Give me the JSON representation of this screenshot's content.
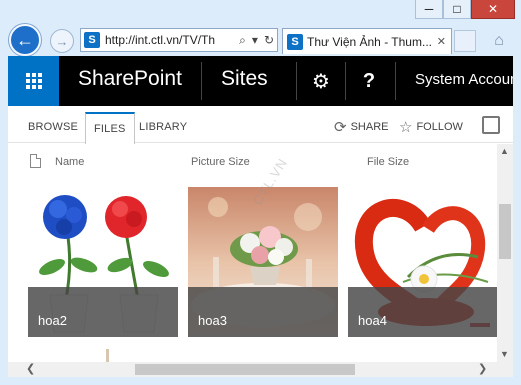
{
  "window": {
    "minimize_glyph": "─",
    "maximize_glyph": "□",
    "close_glyph": "✕"
  },
  "browser": {
    "back_glyph": "←",
    "forward_glyph": "→",
    "address_url": "http://int.ctl.vn/TV/Th",
    "search_glyph": "⌕",
    "dropdown_glyph": "▾",
    "refresh_glyph": "↻",
    "tab_title": "Thư Viện Ảnh - Thum...",
    "tab_close_glyph": "✕",
    "home_glyph": "⌂",
    "favicon_letter": "S"
  },
  "suitebar": {
    "brand": "SharePoint",
    "sites": "Sites",
    "gear_glyph": "⚙",
    "help_glyph": "?",
    "account": "System Account"
  },
  "ribbon": {
    "tabs": [
      "BROWSE",
      "FILES",
      "LIBRARY"
    ],
    "active_tab": "FILES",
    "share_label": "SHARE",
    "share_glyph": "⟳",
    "follow_label": "FOLLOW",
    "follow_glyph": "☆"
  },
  "library": {
    "columns": [
      "Name",
      "Picture Size",
      "File Size"
    ],
    "watermark": "CTL.VN",
    "items": [
      {
        "caption": "hoa2"
      },
      {
        "caption": "hoa3"
      },
      {
        "caption": "hoa4"
      }
    ]
  },
  "scroll": {
    "up_glyph": "▲",
    "down_glyph": "▼",
    "left_glyph": "❮",
    "right_glyph": "❯"
  },
  "colors": {
    "suite_bar": "#000000",
    "waffle": "#0072c6",
    "accent": "#0072c6"
  }
}
